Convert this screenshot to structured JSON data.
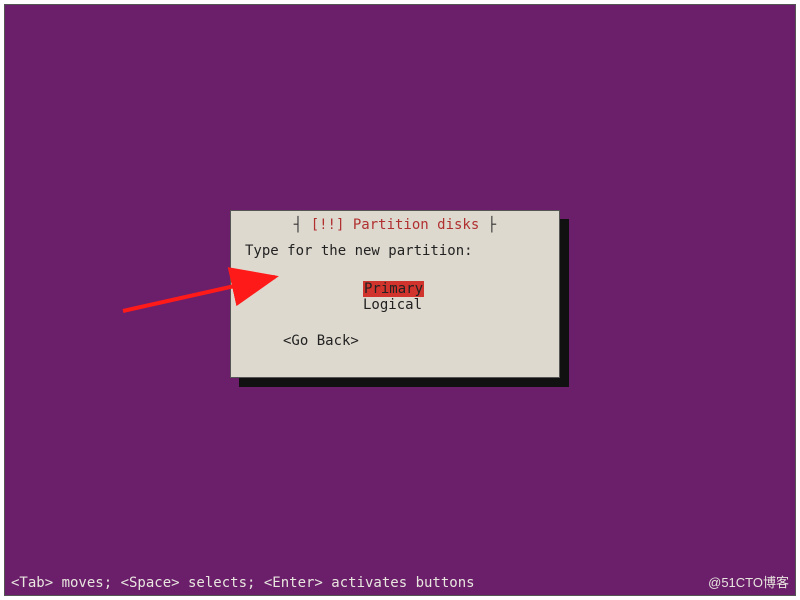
{
  "dialog": {
    "title_prefix": "[!!]",
    "title": "Partition disks",
    "prompt": "Type for the new partition:",
    "options": [
      {
        "label": "Primary",
        "selected": true
      },
      {
        "label": "Logical",
        "selected": false
      }
    ],
    "go_back": "<Go Back>"
  },
  "helpbar": "<Tab> moves; <Space> selects; <Enter> activates buttons",
  "watermark": "@51CTO博客",
  "colors": {
    "background": "#6b1f6b",
    "panel": "#ded9cf",
    "highlight": "#d0342c",
    "title_text": "#b03030"
  },
  "annotation": {
    "arrow_points_to": "Primary option"
  }
}
